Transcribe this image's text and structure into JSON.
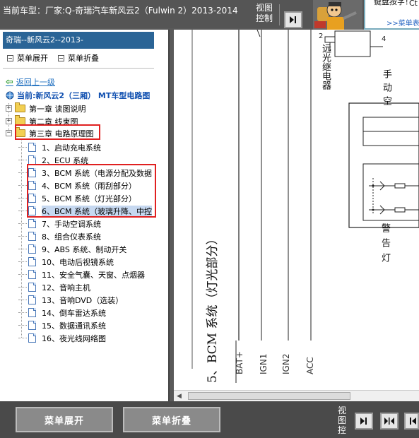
{
  "title": {
    "app_title": "当前车型：厂家:Q-奇瑞汽车新风云2（Fulwin 2）2013-2014",
    "view_control_label": "视图控制",
    "tip_text": "键盘按字！",
    "tip_extra": "Ct",
    "tip_link": ">>菜单表"
  },
  "sidebar": {
    "header": "奇瑞--新风云2--2013-",
    "expand_all": "菜单展开",
    "collapse_all": "菜单折叠",
    "back_link": "返回上一级",
    "current_label": "当前:新风云2（三厢） MT车型电路图",
    "chapters": [
      {
        "label": "第一章 读图说明",
        "expander": "+"
      },
      {
        "label": "第二章 线束图",
        "expander": "+"
      },
      {
        "label": "第三章 电路原理图",
        "expander": "−"
      }
    ],
    "items": [
      "1、启动充电系统",
      "2、ECU 系统",
      "3、BCM 系统（电源分配及数据",
      "4、BCM 系统（雨刮部分）",
      "5、BCM 系统（灯光部分）",
      "6、BCM 系统（玻璃升降、中控",
      "7、手动空调系统",
      "8、组合仪表系统",
      "9、ABS 系统、制动开关",
      "10、电动后视镜系统",
      "11、安全气囊、天窗、点烟器",
      "12、音响主机",
      "13、音响DVD（选装）",
      "14、倒车雷达系统",
      "15、数据通讯系统",
      "16、夜光线网络图"
    ],
    "selected_index": 5
  },
  "diagram": {
    "section_title": "5、BCM 系统（灯光部分）",
    "pins": [
      "BAT+",
      "IGN1",
      "IGN2",
      "ACC"
    ],
    "relay_label": "远光继电器",
    "manual_label": "手动空",
    "warn_label": "警告灯",
    "pin2": "2",
    "pin4": "4"
  },
  "bottom": {
    "expand_btn": "菜单展开",
    "collapse_btn": "菜单折叠",
    "view_control_label": "视图控"
  },
  "colors": {
    "accent_blue": "#2a6496",
    "highlight_red": "#e02020",
    "selection": "#c6d8f0"
  }
}
